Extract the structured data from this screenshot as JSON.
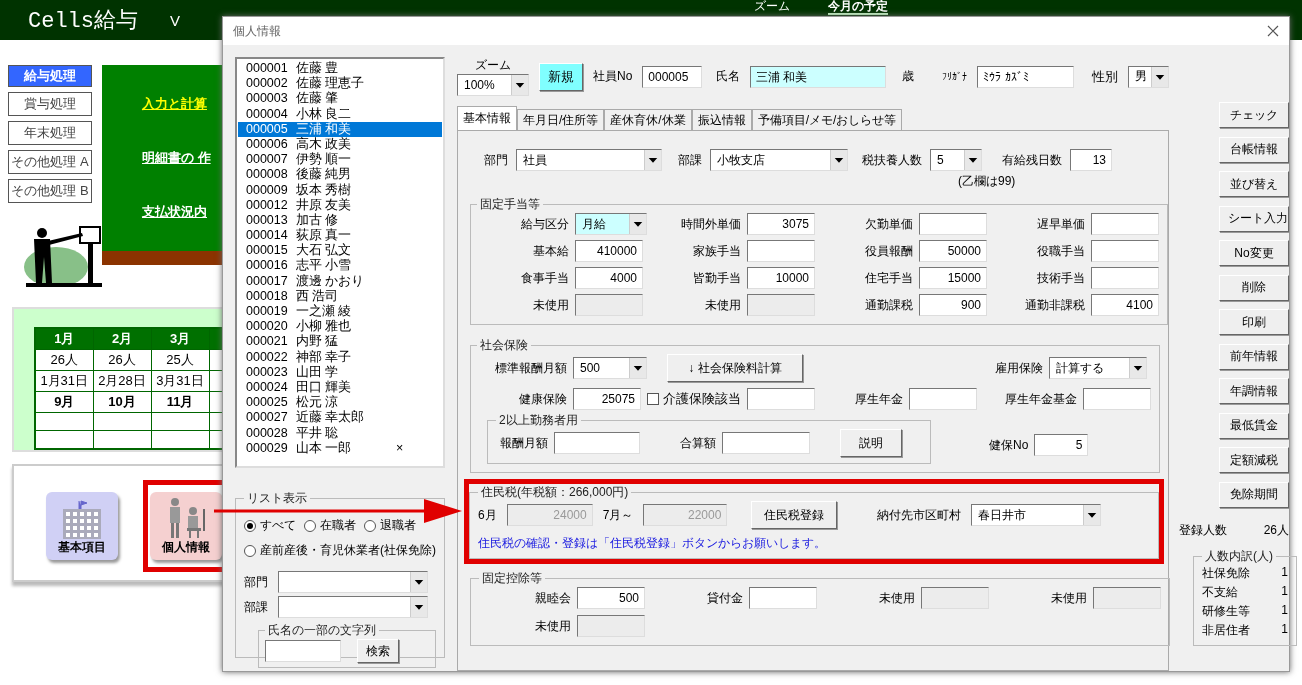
{
  "app": {
    "title": "Cells給与",
    "version": "V",
    "top_menu": [
      {
        "label": "ズーム",
        "selected": false
      },
      {
        "label": "今月の予定",
        "selected": true
      }
    ]
  },
  "side_menu": [
    {
      "label": "給与処理",
      "selected": true
    },
    {
      "label": "賞与処理",
      "selected": false
    },
    {
      "label": "年末処理",
      "selected": false
    },
    {
      "label": "その他処理 A",
      "selected": false
    },
    {
      "label": "その他処理 B",
      "selected": false
    }
  ],
  "board_links": [
    {
      "label": "入力と計算",
      "selected": true
    },
    {
      "label": "明細書の 作",
      "selected": false
    },
    {
      "label": "支払状況内",
      "selected": false
    }
  ],
  "calendar": {
    "columns": [
      "1月",
      "2月",
      "3月"
    ],
    "rows": [
      {
        "cells": [
          "26人",
          "26人",
          "25人"
        ],
        "bold": false
      },
      {
        "cells": [
          "1月31日",
          "2月28日",
          "3月31日"
        ],
        "bold": false
      },
      {
        "cells": [
          "9月",
          "10月",
          "11月"
        ],
        "bold": true
      }
    ]
  },
  "shortcuts": [
    {
      "label": "基本項目",
      "kind": "building",
      "highlighted": false
    },
    {
      "label": "個人情報",
      "kind": "people",
      "highlighted": true
    }
  ],
  "dialog": {
    "title": "個人情報",
    "employees": [
      {
        "no": "000001",
        "name": "佐藤 豊",
        "selected": false
      },
      {
        "no": "000002",
        "name": "佐藤 理恵子",
        "selected": false
      },
      {
        "no": "000003",
        "name": "佐藤 肇",
        "selected": false
      },
      {
        "no": "000004",
        "name": "小林 良二",
        "selected": false
      },
      {
        "no": "000005",
        "name": "三浦 和美",
        "selected": true
      },
      {
        "no": "000006",
        "name": "高木 政美",
        "selected": false
      },
      {
        "no": "000007",
        "name": "伊勢 順一",
        "selected": false
      },
      {
        "no": "000008",
        "name": "後藤 純男",
        "selected": false
      },
      {
        "no": "000009",
        "name": "坂本 秀樹",
        "selected": false
      },
      {
        "no": "000012",
        "name": "井原 友美",
        "selected": false
      },
      {
        "no": "000013",
        "name": "加古 修",
        "selected": false
      },
      {
        "no": "000014",
        "name": "荻原 真一",
        "selected": false
      },
      {
        "no": "000015",
        "name": "大石 弘文",
        "selected": false
      },
      {
        "no": "000016",
        "name": "志平 小雪",
        "selected": false
      },
      {
        "no": "000017",
        "name": "渡邊 かおり",
        "selected": false
      },
      {
        "no": "000018",
        "name": "西 浩司",
        "selected": false
      },
      {
        "no": "000019",
        "name": "一之瀬 綾",
        "selected": false
      },
      {
        "no": "000020",
        "name": "小柳 雅也",
        "selected": false
      },
      {
        "no": "000021",
        "name": "内野 猛",
        "selected": false
      },
      {
        "no": "000022",
        "name": "神部 幸子",
        "selected": false
      },
      {
        "no": "000023",
        "name": "山田 学",
        "selected": false
      },
      {
        "no": "000024",
        "name": "田口 輝美",
        "selected": false
      },
      {
        "no": "000025",
        "name": "松元 涼",
        "selected": false
      },
      {
        "no": "000027",
        "name": "近藤 幸太郎",
        "selected": false
      },
      {
        "no": "000028",
        "name": "平井 聡",
        "selected": false
      },
      {
        "no": "000029",
        "name": "山本 一郎",
        "mark": "×",
        "selected": false
      }
    ],
    "list_filter": {
      "title": "リスト表示",
      "options": [
        {
          "label": "すべて",
          "selected": true
        },
        {
          "label": "在職者",
          "selected": false
        },
        {
          "label": "退職者",
          "selected": false
        },
        {
          "label": "産前産後・育児休業者(社保免除)",
          "selected": false
        }
      ],
      "department_label": "部門",
      "section_label": "部課",
      "search_title": "氏名の一部の文字列",
      "search_button": "検索"
    },
    "header": {
      "zoom_label": "ズーム",
      "zoom": "100%",
      "new_button": "新規",
      "employee_no_label": "社員No",
      "employee_no": "000005",
      "name_label": "氏名",
      "name": "三浦 和美",
      "age_unit": "歳",
      "kana_label": "ﾌﾘｶﾞﾅ",
      "kana": "ﾐｳﾗ ｶｽﾞﾐ",
      "sex_label": "性別",
      "sex": "男"
    },
    "tabs": [
      {
        "label": "基本情報",
        "selected": true
      },
      {
        "label": "年月日/住所等",
        "selected": false
      },
      {
        "label": "産休育休/休業",
        "selected": false
      },
      {
        "label": "振込情報",
        "selected": false
      },
      {
        "label": "予備項目/メモ/おしらせ等",
        "selected": false
      }
    ],
    "basic": {
      "department_label": "部門",
      "department": "社員",
      "section_label": "部課",
      "section": "小牧支店",
      "dependents_label": "税扶養人数",
      "dependents": "5",
      "dependents_note": "(乙欄は99)",
      "paid_leave_label": "有給残日数",
      "paid_leave": "13"
    },
    "fixed_allowances": {
      "title": "固定手当等",
      "fields": [
        {
          "kind": "combo",
          "label": "給与区分",
          "value": "月給",
          "highlighted": true
        },
        {
          "kind": "field",
          "label": "時間外単価",
          "value": "3075"
        },
        {
          "kind": "field",
          "label": "欠勤単価"
        },
        {
          "kind": "field",
          "label": "遅早単価"
        },
        {
          "kind": "field",
          "label": "基本給",
          "value": "410000"
        },
        {
          "kind": "field",
          "label": "家族手当"
        },
        {
          "kind": "field",
          "label": "役員報酬",
          "value": "50000"
        },
        {
          "kind": "field",
          "label": "役職手当"
        },
        {
          "kind": "field",
          "label": "食事手当",
          "value": "4000"
        },
        {
          "kind": "field",
          "label": "皆勤手当",
          "value": "10000"
        },
        {
          "kind": "field",
          "label": "住宅手当",
          "value": "15000"
        },
        {
          "kind": "field",
          "label": "技術手当"
        },
        {
          "kind": "field",
          "label": "未使用",
          "disabled": true
        },
        {
          "kind": "field",
          "label": "未使用",
          "disabled": true
        },
        {
          "kind": "field",
          "label": "通勤課税",
          "value": "900"
        },
        {
          "kind": "field",
          "label": "通勤非課税",
          "value": "4100"
        }
      ]
    },
    "social_insurance": {
      "title": "社会保険",
      "standard_label": "標準報酬月額",
      "standard": "500",
      "calc_button": "↓  社会保険料計算",
      "employment_label": "雇用保険",
      "employment": "計算する",
      "health_label": "健康保険",
      "health": "25075",
      "care_label": "介護保険該当",
      "care_checked": false,
      "pension_label": "厚生年金",
      "fund_label": "厚生年金基金",
      "multi_title": "2以上勤務者用",
      "monthly_label": "報酬月額",
      "total_label": "合算額",
      "explain_button": "説明",
      "health_no_label": "健保No",
      "health_no": "5"
    },
    "resident_tax": {
      "title": "住民税(年税額：266,000円)",
      "highlighted": true,
      "june_label": "6月",
      "june": "24000",
      "july_label": "7月～",
      "july": "22000",
      "button": "住民税登録",
      "city_label": "納付先市区町村",
      "city": "春日井市",
      "note": "住民税の確認・登録は「住民税登録」ボタンからお願いします。"
    },
    "fixed_deductions": {
      "title": "固定控除等",
      "fields": [
        {
          "label": "親睦会",
          "value": "500"
        },
        {
          "label": "貸付金"
        },
        {
          "label": "未使用",
          "disabled": true
        },
        {
          "label": "未使用",
          "disabled": true
        },
        {
          "label": "未使用",
          "disabled": true
        }
      ]
    },
    "actions": [
      "チェック",
      "台帳情報",
      "並び替え",
      "シート入力",
      "No変更",
      "削除",
      "印刷",
      "前年情報",
      "年調情報",
      "最低賃金",
      "定額減税",
      "免除期間"
    ],
    "registered": {
      "label": "登録人数",
      "value": "26人"
    },
    "breakdown": {
      "title": "人数内訳(人)",
      "rows": [
        {
          "label": "社保免除",
          "value": "1"
        },
        {
          "label": "不支給",
          "value": "1"
        },
        {
          "label": "研修生等",
          "value": "1"
        },
        {
          "label": "非居住者",
          "value": "1"
        }
      ]
    }
  }
}
